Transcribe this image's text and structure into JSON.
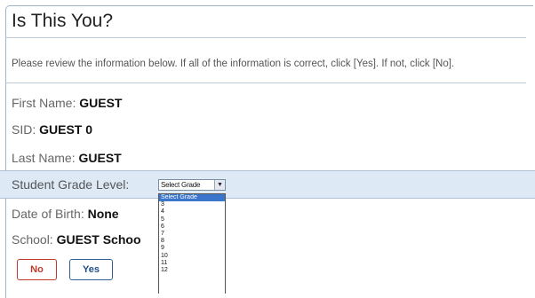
{
  "dialog": {
    "title": "Is This You?",
    "instructions": "Please review the information below. If all of the information is correct, click [Yes]. If not, click [No]."
  },
  "fields": {
    "first_name": {
      "label": "First Name:",
      "value": "GUEST"
    },
    "sid": {
      "label": "SID:",
      "value": "GUEST 0"
    },
    "last_name": {
      "label": "Last Name:",
      "value": "GUEST"
    },
    "grade": {
      "label": "Student Grade Level:",
      "selected": "Select Grade"
    },
    "dob": {
      "label": "Date of Birth:",
      "value": "None"
    },
    "school": {
      "label": "School:",
      "value": "GUEST Schoo"
    }
  },
  "grade_options": [
    "Select Grade",
    "3",
    "4",
    "5",
    "6",
    "7",
    "8",
    "9",
    "10",
    "11",
    "12"
  ],
  "buttons": {
    "no": "No",
    "yes": "Yes"
  },
  "colors": {
    "no_button": "#c0392b",
    "yes_button": "#2f5f94",
    "highlight": "#3a76cc",
    "grade_row_bg": "#dde9f5"
  },
  "icons": {
    "select_arrow": "chevron-down-icon"
  }
}
